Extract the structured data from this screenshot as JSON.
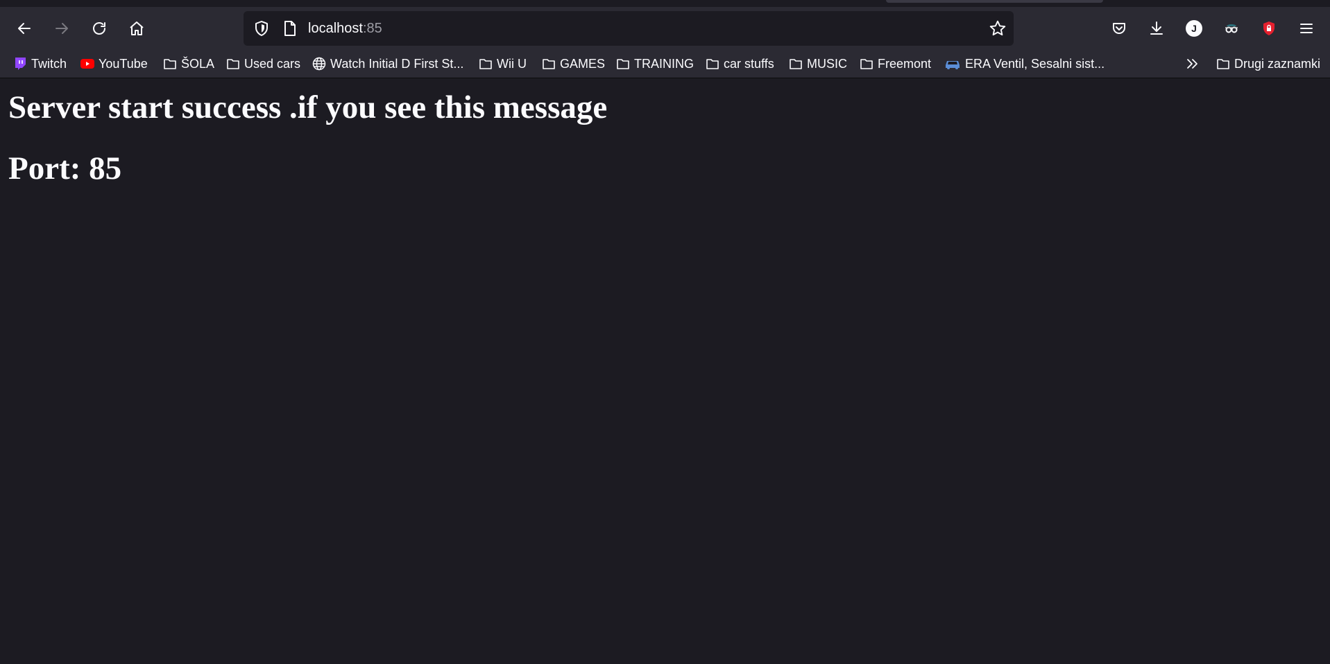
{
  "browser": {
    "url_host": "localhost",
    "url_port": ":85"
  },
  "profile": {
    "initial": "J"
  },
  "bookmarks": [
    {
      "label": "Twitch",
      "icon": "twitch-icon",
      "color": "#9146ff"
    },
    {
      "label": "YouTube",
      "icon": "youtube-icon",
      "color": "#ff0000"
    },
    {
      "label": "ŠOLA",
      "icon": "folder-icon"
    },
    {
      "label": "Used cars",
      "icon": "folder-icon"
    },
    {
      "label": "Watch Initial D First St...",
      "icon": "globe-icon"
    },
    {
      "label": "Wii U",
      "icon": "folder-icon"
    },
    {
      "label": "GAMES",
      "icon": "folder-icon"
    },
    {
      "label": "TRAINING",
      "icon": "folder-icon"
    },
    {
      "label": "car stuffs",
      "icon": "folder-icon"
    },
    {
      "label": "MUSIC",
      "icon": "folder-icon"
    },
    {
      "label": "Freemont",
      "icon": "folder-icon"
    },
    {
      "label": "ERA Ventil, Sesalni sist...",
      "icon": "car-icon"
    },
    {
      "label": "Drugi zaznamki",
      "icon": "folder-icon"
    }
  ],
  "page": {
    "message": "Server start success .if you see this message",
    "port_text": "Port: 85"
  },
  "colors": {
    "chrome_bg": "#2b2a33",
    "page_bg": "#1c1b22",
    "text": "#fbfbfe",
    "ublock_red": "#e5202e"
  }
}
